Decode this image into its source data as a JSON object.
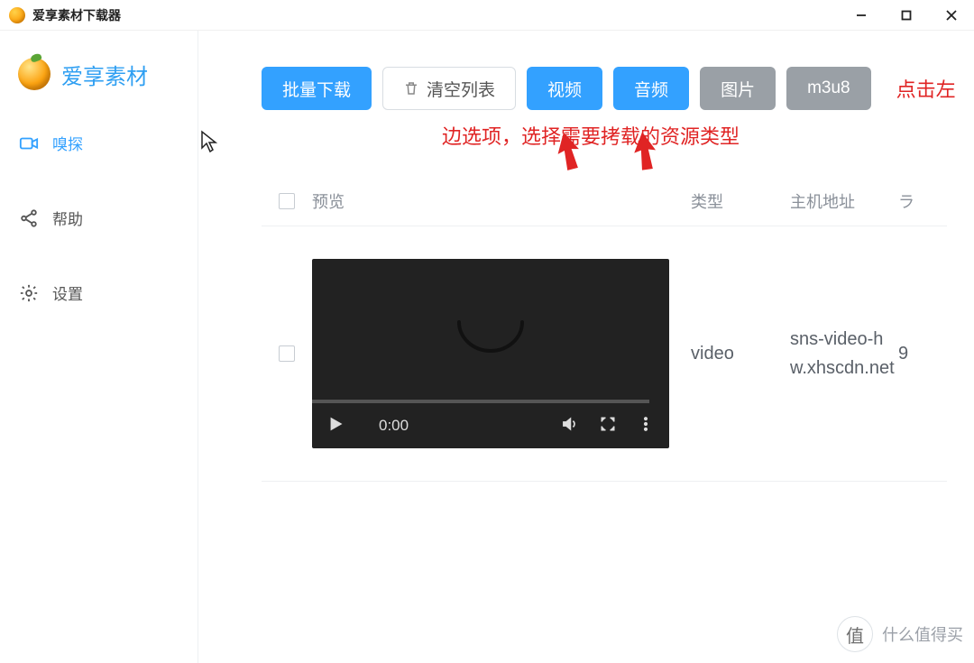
{
  "window": {
    "title": "爱享素材下载器"
  },
  "brand": {
    "name": "爱享素材"
  },
  "sidebar": {
    "items": [
      {
        "label": "嗅探",
        "icon": "camera-icon",
        "active": true
      },
      {
        "label": "帮助",
        "icon": "share-icon",
        "active": false
      },
      {
        "label": "设置",
        "icon": "gear-icon",
        "active": false
      }
    ]
  },
  "toolbar": {
    "batch_download": "批量下载",
    "clear_list": "清空列表",
    "video": "视频",
    "audio": "音频",
    "image": "图片",
    "m3u8": "m3u8"
  },
  "hint": {
    "line1_right": "点击左",
    "line2": "边选项，选择需要拷载的资源类型"
  },
  "table": {
    "headers": {
      "preview": "预览",
      "type": "类型",
      "host": "主机地址",
      "last": "ラ"
    },
    "rows": [
      {
        "time": "0:00",
        "type": "video",
        "host": "sns-video-hw.xhscdn.net",
        "last": "9"
      }
    ]
  },
  "watermark": {
    "icon_text": "值",
    "text": "什么值得买"
  }
}
